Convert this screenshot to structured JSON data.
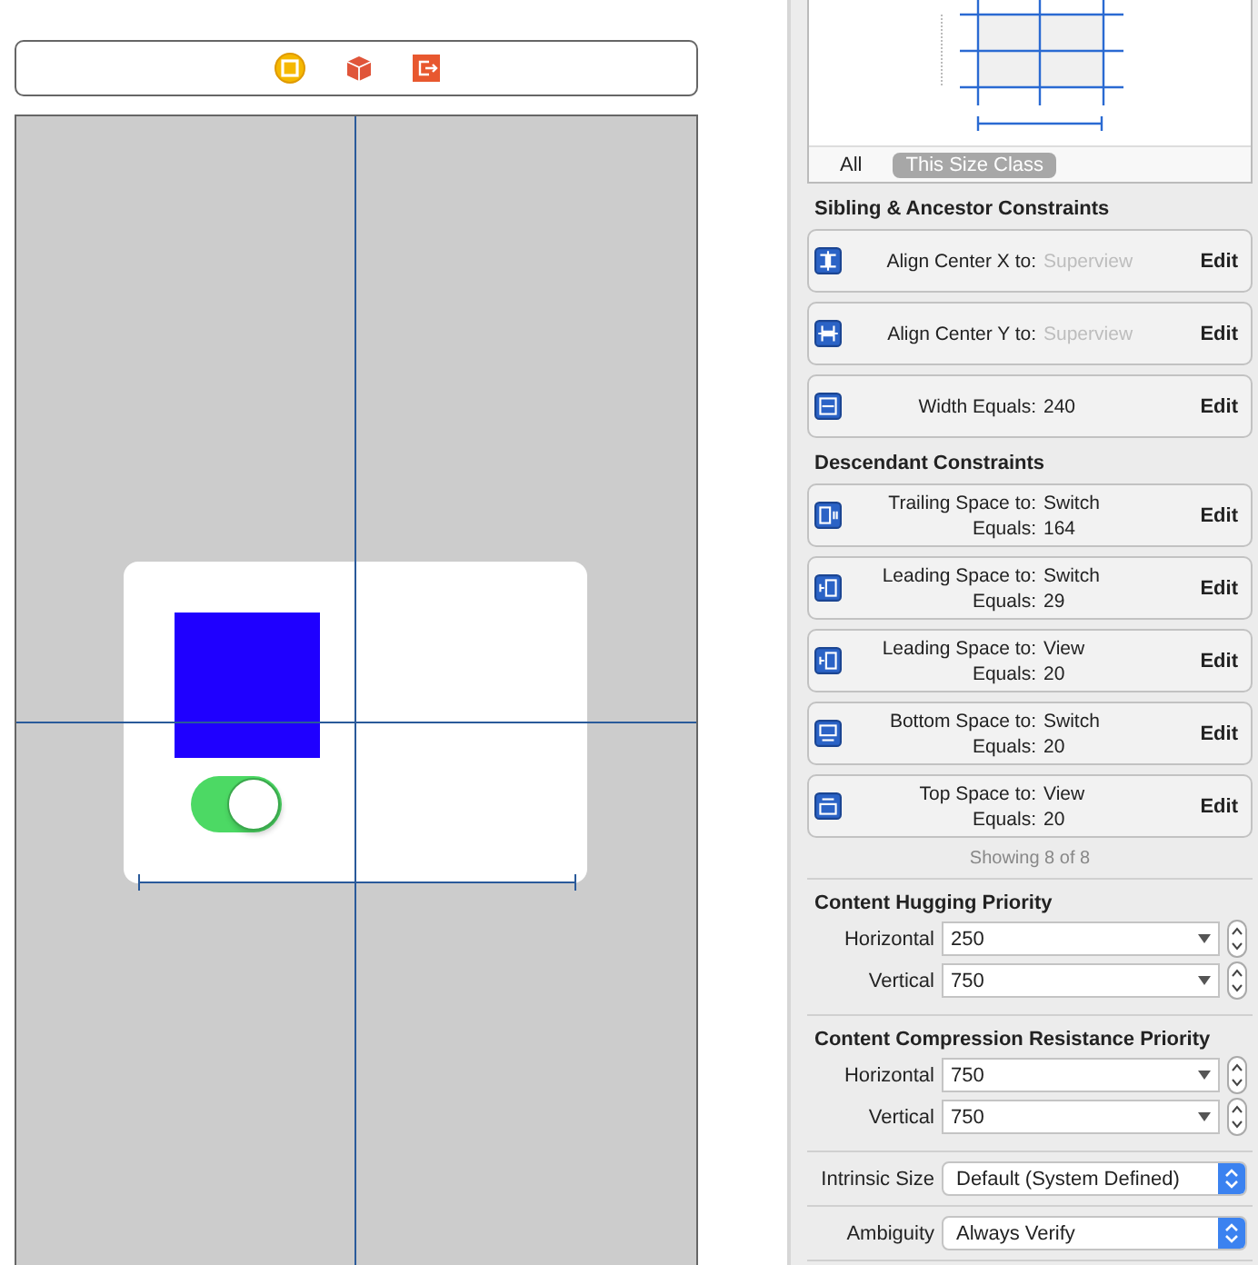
{
  "canvas": {
    "switch": {
      "on": true
    }
  },
  "size_class": {
    "tabs": [
      {
        "label": "All",
        "selected": false
      },
      {
        "label": "This Size Class",
        "selected": true
      }
    ]
  },
  "sibling_constraints": {
    "title": "Sibling & Ancestor Constraints",
    "items": [
      {
        "kind": "center_x",
        "label": "Align Center X to:",
        "target": "Superview",
        "dimmed": true,
        "action": "Edit"
      },
      {
        "kind": "center_y",
        "label": "Align Center Y to:",
        "target": "Superview",
        "dimmed": true,
        "action": "Edit"
      },
      {
        "kind": "width",
        "label": "Width Equals:",
        "target": "240",
        "dimmed": false,
        "action": "Edit"
      }
    ]
  },
  "descendant_constraints": {
    "title": "Descendant Constraints",
    "items": [
      {
        "kind": "trailing",
        "label": "Trailing Space to:",
        "target": "Switch",
        "dimmed": false,
        "equals_label": "Equals:",
        "equals": "164",
        "action": "Edit"
      },
      {
        "kind": "leading",
        "label": "Leading Space to:",
        "target": "Switch",
        "dimmed": false,
        "equals_label": "Equals:",
        "equals": "29",
        "action": "Edit"
      },
      {
        "kind": "leading",
        "label": "Leading Space to:",
        "target": "View",
        "dimmed": false,
        "equals_label": "Equals:",
        "equals": "20",
        "action": "Edit"
      },
      {
        "kind": "bottom",
        "label": "Bottom Space to:",
        "target": "Switch",
        "dimmed": false,
        "equals_label": "Equals:",
        "equals": "20",
        "action": "Edit"
      },
      {
        "kind": "top",
        "label": "Top Space to:",
        "target": "View",
        "dimmed": false,
        "equals_label": "Equals:",
        "equals": "20",
        "action": "Edit"
      }
    ],
    "footer": "Showing 8 of 8"
  },
  "content_hugging": {
    "title": "Content Hugging Priority",
    "rows": [
      {
        "label": "Horizontal",
        "value": "250"
      },
      {
        "label": "Vertical",
        "value": "750"
      }
    ]
  },
  "compression_resistance": {
    "title": "Content Compression Resistance Priority",
    "rows": [
      {
        "label": "Horizontal",
        "value": "750"
      },
      {
        "label": "Vertical",
        "value": "750"
      }
    ]
  },
  "intrinsic_size": {
    "label": "Intrinsic Size",
    "value": "Default (System Defined)"
  },
  "ambiguity": {
    "label": "Ambiguity",
    "value": "Always Verify"
  }
}
